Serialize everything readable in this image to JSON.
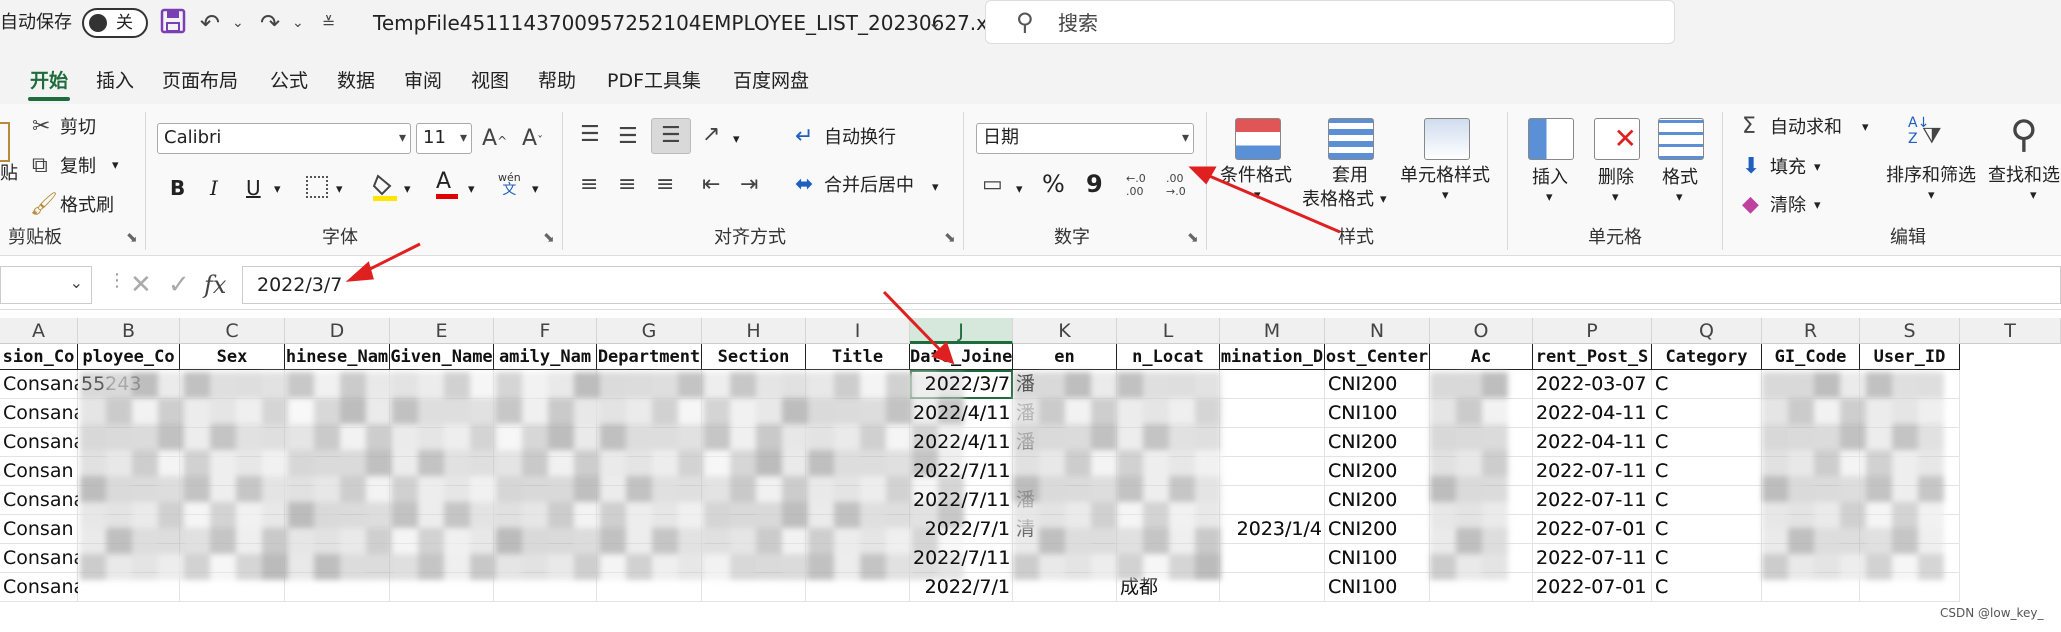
{
  "titlebar": {
    "autosave_label": "自动保存",
    "autosave_state": "关",
    "filename": "TempFile4511143700957252104EMPLOYEE_LIST_20230627.x...",
    "search_placeholder": "搜索"
  },
  "tabs": [
    "开始",
    "插入",
    "页面布局",
    "公式",
    "数据",
    "审阅",
    "视图",
    "帮助",
    "PDF工具集",
    "百度网盘"
  ],
  "ribbon": {
    "clipboard": {
      "paste": "贴",
      "cut": "剪切",
      "copy": "复制",
      "format_painter": "格式刷",
      "group": "剪贴板"
    },
    "font": {
      "name": "Calibri",
      "size": "11",
      "grow": "A^",
      "shrink": "Aˇ",
      "bold": "B",
      "italic": "I",
      "underline": "U",
      "phonetic_top": "wén",
      "phonetic_bottom": "文",
      "group": "字体"
    },
    "alignment": {
      "wrap": "自动换行",
      "merge": "合并后居中",
      "group": "对齐方式"
    },
    "number": {
      "format": "日期",
      "percent": "%",
      "comma": "9",
      "group": "数字"
    },
    "styles": {
      "conditional": "条件格式",
      "table_line1": "套用",
      "table_line2": "表格格式",
      "cell_styles": "单元格样式",
      "group": "样式"
    },
    "cells": {
      "insert": "插入",
      "delete": "删除",
      "format": "格式",
      "group": "单元格"
    },
    "editing": {
      "autosum": "自动求和",
      "fill": "填充",
      "clear": "清除",
      "sort": "排序和筛选",
      "find": "查找和选",
      "group": "编辑"
    }
  },
  "formula": {
    "fx": "fx",
    "value": "2022/3/7"
  },
  "columns": [
    "A",
    "B",
    "C",
    "D",
    "E",
    "F",
    "G",
    "H",
    "I",
    "J",
    "K",
    "L",
    "M",
    "N",
    "O",
    "P",
    "Q",
    "R",
    "S",
    "T"
  ],
  "headers": [
    "sion_Co",
    "ployee_Co",
    "Sex",
    "hinese_Nam",
    "Given_Name",
    "amily_Nam",
    "Department",
    "Section",
    "Title",
    "Date_Joine",
    "en",
    "n_Locat",
    "mination_D",
    "ost_Center",
    "Ac",
    "rent_Post_S",
    "Category",
    "GI_Code",
    "User_ID"
  ],
  "rows": [
    {
      "a": "Consana",
      "b": "55243",
      "j": "2022/3/7",
      "k": "潘",
      "m": "",
      "n": "CNI200",
      "p": "2022-03-07",
      "q": "C"
    },
    {
      "a": "Consana",
      "b": "",
      "j": "2022/4/11",
      "k": "潘",
      "m": "",
      "n": "CNI100",
      "p": "2022-04-11",
      "q": "C"
    },
    {
      "a": "Consana",
      "b": "",
      "j": "2022/4/11",
      "k": "潘",
      "m": "",
      "n": "CNI200",
      "p": "2022-04-11",
      "q": "C"
    },
    {
      "a": "Consan",
      "b": "",
      "j": "2022/7/11",
      "k": "",
      "m": "",
      "n": "CNI200",
      "p": "2022-07-11",
      "q": "C"
    },
    {
      "a": "Consana",
      "b": "",
      "j": "2022/7/11",
      "k": "潘",
      "m": "",
      "n": "CNI200",
      "p": "2022-07-11",
      "q": "C"
    },
    {
      "a": "Consan",
      "b": "",
      "j": "2022/7/1",
      "k": "清",
      "m": "2023/1/4",
      "n": "CNI200",
      "p": "2022-07-01",
      "q": "C"
    },
    {
      "a": "Consana",
      "b": "",
      "j": "2022/7/11",
      "k": "",
      "m": "",
      "n": "CNI100",
      "p": "2022-07-11",
      "q": "C"
    },
    {
      "a": "Consana",
      "b": "",
      "j": "2022/7/1",
      "k": "",
      "l": "成都",
      "m": "",
      "n": "CNI100",
      "p": "2022-07-01",
      "q": "C"
    }
  ],
  "partial": {
    "r1c": "Cel",
    "r7k": "Cel",
    "o4": "y",
    "o5": "x",
    "o2": "d",
    "o3": "f",
    "o6": "l",
    "o7": "sh",
    "o8": "qian",
    "o9": "ma"
  },
  "watermark": "CSDN @low_key_",
  "colors": {
    "accent": "#1e6b3c",
    "arrow": "#e02020"
  }
}
